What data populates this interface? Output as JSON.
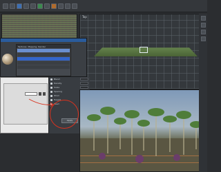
{
  "toolbar": {
    "items": [
      "file",
      "edit",
      "render",
      "select",
      "move",
      "rotate",
      "scale",
      "layer",
      "material",
      "light",
      "camera"
    ],
    "label": ""
  },
  "viewport_top_right": {
    "title": "Top"
  },
  "material_editor": {
    "header_tabs": [
      "Textures",
      "Mapping",
      "Render"
    ],
    "list_rows": 7
  },
  "dialog": {
    "close_label": "×"
  },
  "properties": {
    "rows": [
      "Blend",
      "Density",
      "Scale",
      "Spacing",
      "Wind",
      "Height",
      "Seed"
    ],
    "apply_label": "Apply"
  },
  "colors": {
    "accent": "#2a5c9c",
    "annotation": "#d9321e"
  }
}
